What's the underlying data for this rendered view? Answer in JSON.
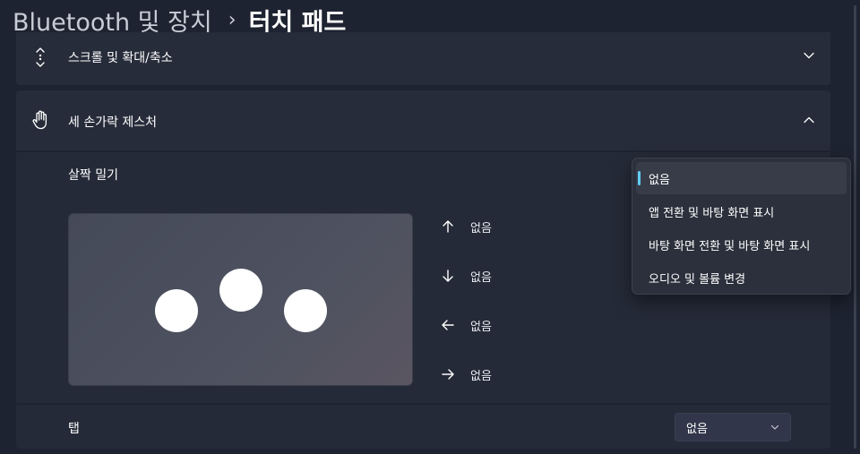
{
  "header": {
    "parent": "Bluetooth 및 장치",
    "separator": "›",
    "current": "터치 패드"
  },
  "scroll_zoom": {
    "label": "스크롤 및 확대/축소",
    "icon": "scroll-updown-icon"
  },
  "three_finger": {
    "label": "세 손가락 제스처",
    "icon": "hand-icon",
    "expanded": true
  },
  "swipe": {
    "title": "살짝 밀기",
    "directions": [
      {
        "icon": "arrow-up-icon",
        "value": "없음"
      },
      {
        "icon": "arrow-down-icon",
        "value": "없음"
      },
      {
        "icon": "arrow-left-icon",
        "value": "없음"
      },
      {
        "icon": "arrow-right-icon",
        "value": "없음"
      }
    ]
  },
  "tap": {
    "label": "탭",
    "value": "없음"
  },
  "dropdown": {
    "options": [
      {
        "label": "없음",
        "selected": true
      },
      {
        "label": "앱 전환 및 바탕 화면 표시",
        "selected": false
      },
      {
        "label": "바탕 화면 전환 및 바탕 화면 표시",
        "selected": false
      },
      {
        "label": "오디오 및 볼륨 변경",
        "selected": false
      }
    ]
  },
  "colors": {
    "accent": "#60cdff",
    "background": "#1e2331",
    "card": "#272c3a"
  }
}
